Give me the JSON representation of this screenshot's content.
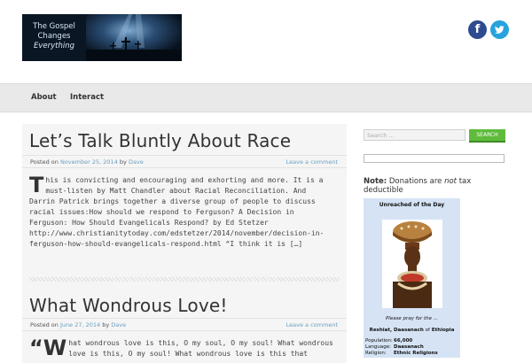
{
  "logo": {
    "line1": "The Gospel",
    "line2": "Changes",
    "line3": "Everything"
  },
  "social": {
    "facebook": "f",
    "twitter": "t",
    "facebook_color": "#2d4b8e",
    "twitter_color": "#27a2dc"
  },
  "nav": {
    "items": [
      "About",
      "Interact"
    ]
  },
  "posts": [
    {
      "title": "Let’s Talk Bluntly About Race",
      "posted_on_label": "Posted on",
      "date": "November 25, 2014",
      "by_label": "by",
      "author": "Dave",
      "comment_link": "Leave a comment",
      "dropcap": "T",
      "excerpt": "his is convicting and encouraging and exhorting and more. It is a must-listen by Matt Chandler about Racial Reconciliation. And Darrin Patrick brings together a diverse group of people to discuss racial issues:How should we respond to Ferguson?   A Decision in Ferguson: How Should Evangelicals Respond? by Ed Stetzer http://www.christianitytoday.com/edstetzer/2014/november/decision-in-ferguson-how-should-evangelicals-respond.html “I think it is […]"
    },
    {
      "title": "What Wondrous Love!",
      "posted_on_label": "Posted on",
      "date": "June 27, 2014",
      "by_label": "by",
      "author": "Dave",
      "comment_link": "Leave a comment",
      "dropcap": "“W",
      "excerpt": "hat wondrous love is this, O my soul, O my soul! What wondrous love is this, O my soul! What wondrous love is this that"
    }
  ],
  "sidebar": {
    "search_placeholder": "Search …",
    "search_button": "SEARCH",
    "note_label": "Note:",
    "note_text_1": "Donations are ",
    "note_text_em": "not",
    "note_text_2": " tax deductible",
    "unreached": {
      "title": "Unreached of the Day",
      "pray": "Please pray for the ...",
      "people": "Reshiat, Daasanach",
      "of_label": "of",
      "country": "Ethiopia",
      "stats": [
        {
          "label": "Population:",
          "value": "66,000"
        },
        {
          "label": "Language:",
          "value": "Daasanach"
        },
        {
          "label": "Religion:",
          "value": "Ethnic Religions"
        }
      ]
    }
  }
}
